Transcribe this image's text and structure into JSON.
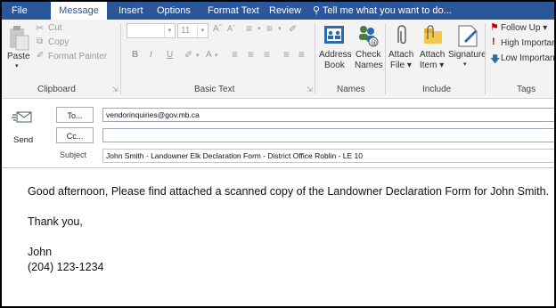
{
  "tabs": [
    {
      "label": "File"
    },
    {
      "label": "Message"
    },
    {
      "label": "Insert"
    },
    {
      "label": "Options"
    },
    {
      "label": "Format Text"
    },
    {
      "label": "Review"
    }
  ],
  "tell_me": "Tell me what you want to do...",
  "clipboard": {
    "paste": "Paste",
    "cut": "Cut",
    "copy": "Copy",
    "format_painter": "Format Painter",
    "label": "Clipboard"
  },
  "basic_text": {
    "font_size": "11",
    "label": "Basic Text"
  },
  "names": {
    "address_book": [
      "Address",
      "Book"
    ],
    "check_names": [
      "Check",
      "Names"
    ],
    "label": "Names"
  },
  "include": {
    "attach_file": [
      "Attach",
      "File ▾"
    ],
    "attach_item": [
      "Attach",
      "Item ▾"
    ],
    "signature": "Signature",
    "label": "Include"
  },
  "tags": {
    "follow_up": "Follow Up ▾",
    "high_importance": "High Importance",
    "low_importance": "Low Importance",
    "label": "Tags"
  },
  "message_header": {
    "send": "Send",
    "to_button": "To...",
    "to_value": "vendorinquiries@gov.mb.ca",
    "cc_button": "Cc...",
    "cc_value": "",
    "subject_label": "Subject",
    "subject_value": "John Smith - Landowner Elk Declaration Form - District Office Roblin - LE 10"
  },
  "body": {
    "line1": "Good afternoon, Please find attached a scanned copy of the Landowner Declaration Form for John Smith.",
    "line2": "Thank you,",
    "line3": "John",
    "line4": "(204) 123-1234"
  }
}
